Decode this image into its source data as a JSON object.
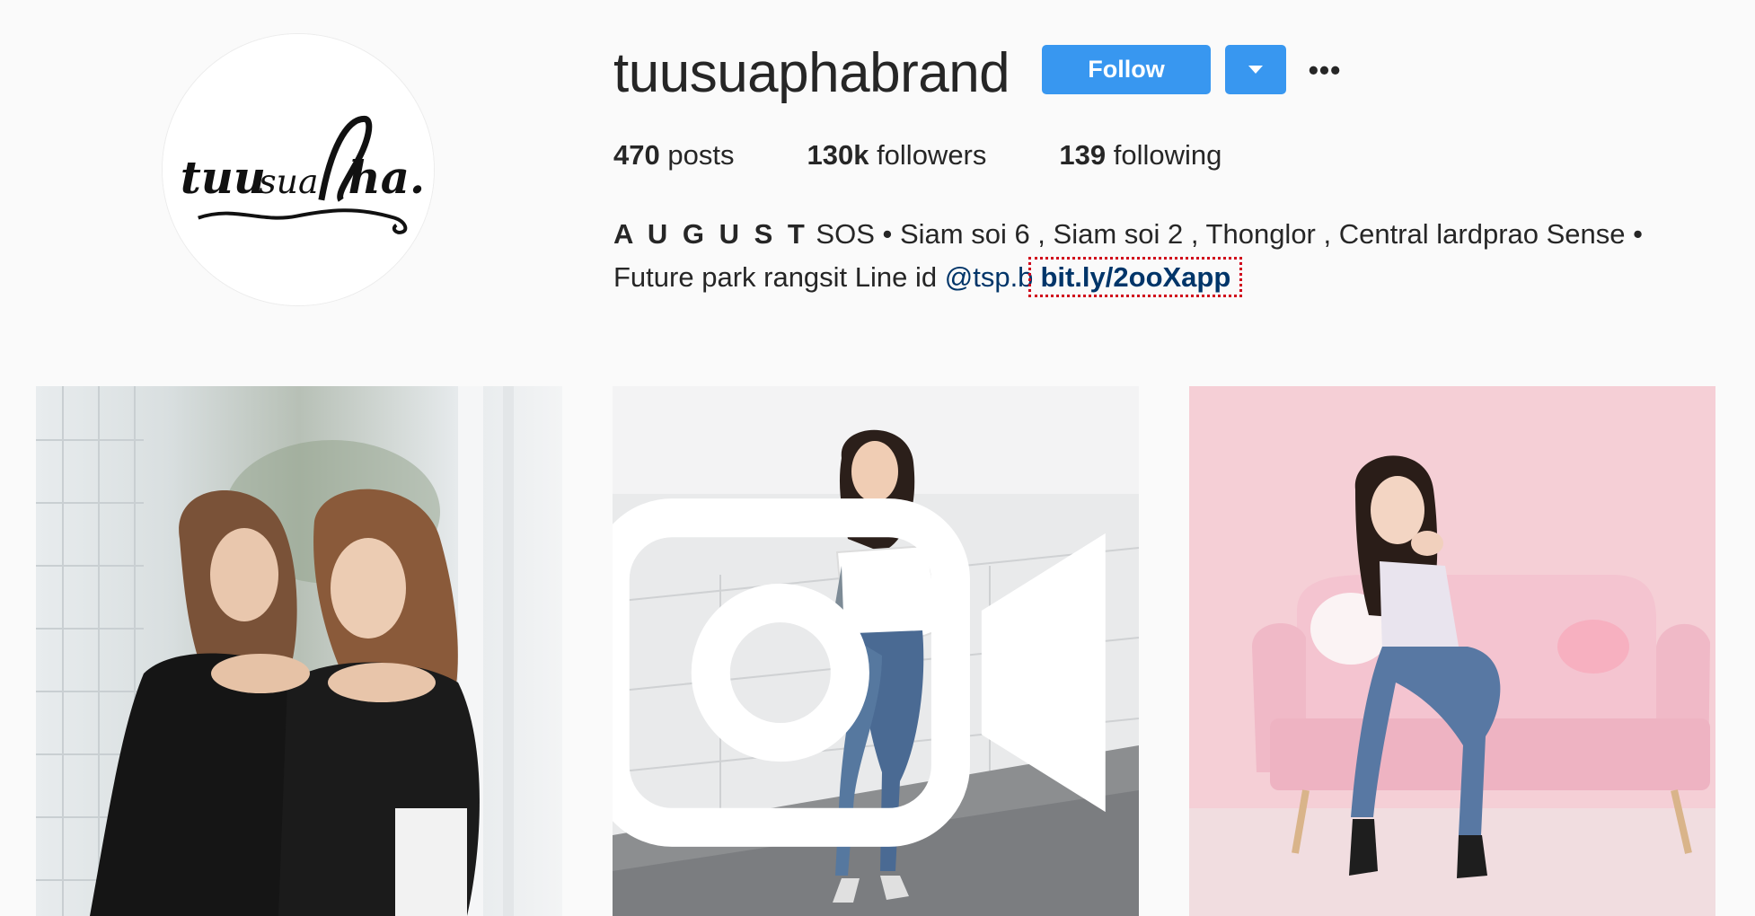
{
  "profile": {
    "username": "tuusuaphabrand",
    "avatar_logo_text": "tuu sua pha.",
    "follow_label": "Follow",
    "more_label": "•••"
  },
  "stats": {
    "posts_count": "470",
    "posts_label": "posts",
    "followers_count": "130k",
    "followers_label": "followers",
    "following_count": "139",
    "following_label": "following"
  },
  "bio": {
    "lead": "A U G U S T",
    "line1": " SOS • Siam soi 6 , Siam soi 2 , Thonglor , Central lardprao Sense •",
    "line2": "Future park rangsit Line id ",
    "mention": "@tsp.b",
    "link": "bit.ly/2ooXapp"
  },
  "posts": [
    {
      "icon": "photo"
    },
    {
      "icon": "video-icon"
    },
    {
      "icon": "photo"
    }
  ],
  "colors": {
    "accent": "#3897f0",
    "link": "#003569",
    "background": "#fafafa"
  }
}
